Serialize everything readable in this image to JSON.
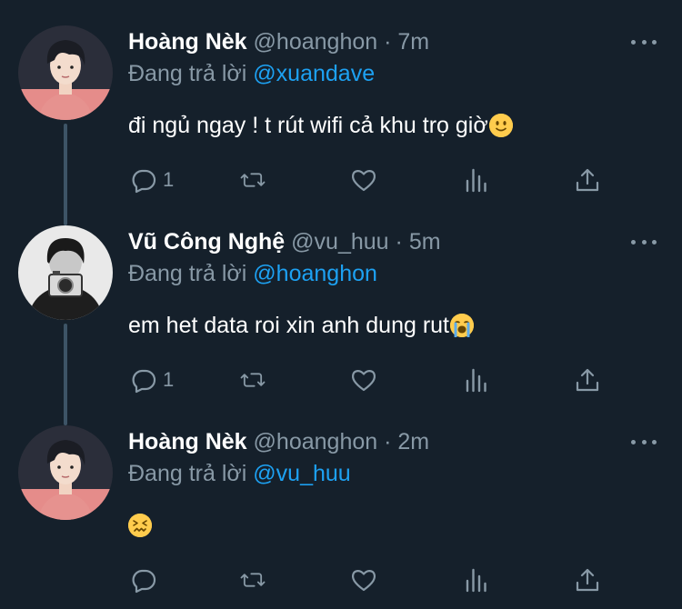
{
  "tweets": [
    {
      "name": "Hoàng Nèk",
      "handle": "@hoanghon",
      "separator": "·",
      "time": "7m",
      "replying_prefix": "Đang trả lời",
      "replying_to": "@xuandave",
      "text": "đi ngủ ngay ! t rút wifi cả khu trọ giờ",
      "emoji": "slightly-smiling-face",
      "reply_count": "1",
      "avatar_style": "pink"
    },
    {
      "name": "Vũ Công Nghệ",
      "handle": "@vu_huu",
      "separator": "·",
      "time": "5m",
      "replying_prefix": "Đang trả lời",
      "replying_to": "@hoanghon",
      "text": "em het data roi xin anh dung rut",
      "emoji": "loudly-crying-face",
      "reply_count": "1",
      "avatar_style": "bw-camera"
    },
    {
      "name": "Hoàng Nèk",
      "handle": "@hoanghon",
      "separator": "·",
      "time": "2m",
      "replying_prefix": "Đang trả lời",
      "replying_to": "@vu_huu",
      "text": "",
      "emoji": "confounded-face",
      "reply_count": "",
      "avatar_style": "pink"
    }
  ],
  "icons": [
    "reply-icon",
    "retweet-icon",
    "like-icon",
    "analytics-icon",
    "share-icon",
    "more-icon"
  ],
  "colors": {
    "background": "#15202b",
    "muted": "#8899a6",
    "link": "#1da1f2",
    "text": "#ffffff"
  }
}
